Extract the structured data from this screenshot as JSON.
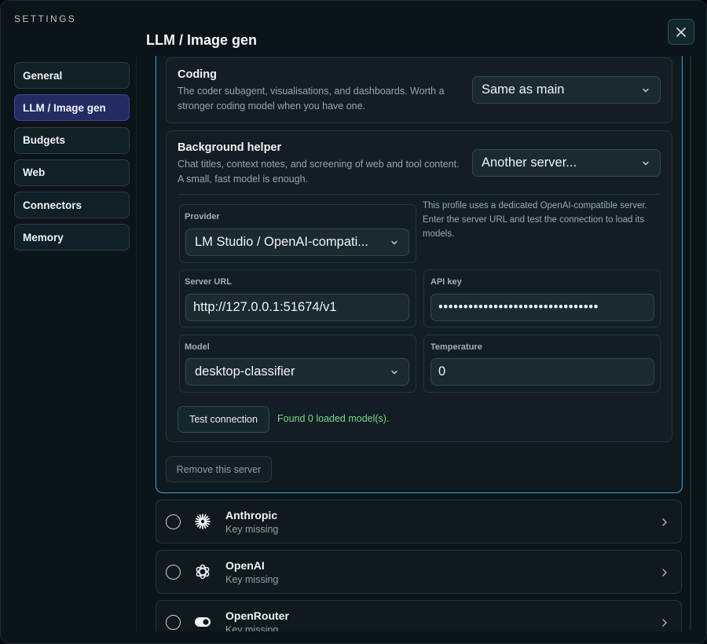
{
  "header": {
    "settings_label": "SETTINGS",
    "page_title": "LLM / Image gen"
  },
  "sidebar": {
    "items": [
      {
        "label": "General",
        "active": false
      },
      {
        "label": "LLM / Image gen",
        "active": true
      },
      {
        "label": "Budgets",
        "active": false
      },
      {
        "label": "Web",
        "active": false
      },
      {
        "label": "Connectors",
        "active": false
      },
      {
        "label": "Memory",
        "active": false
      }
    ]
  },
  "coding": {
    "title": "Coding",
    "description": "The coder subagent, visualisations, and dashboards. Worth a stronger coding model when you have one.",
    "selected": "Same as main"
  },
  "background": {
    "title": "Background helper",
    "description": "Chat titles, context notes, and screening of web and tool content. A small, fast model is enough.",
    "selected": "Another server...",
    "hint": "This profile uses a dedicated OpenAI-compatible server. Enter the server URL and test the connection to load its models.",
    "provider_label": "Provider",
    "provider_value": "LM Studio / OpenAI-compati...",
    "server_url_label": "Server URL",
    "server_url_value": "http://127.0.0.1:51674/v1",
    "api_key_label": "API key",
    "api_key_value": "••••••••••••••••••••••••••••••••",
    "model_label": "Model",
    "model_value": "desktop-classifier",
    "temperature_label": "Temperature",
    "temperature_value": "0",
    "test_button": "Test connection",
    "test_result": "Found 0 loaded model(s)."
  },
  "remove_button": "Remove this server",
  "providers": [
    {
      "name": "Anthropic",
      "status": "Key missing",
      "icon": "anthropic-icon"
    },
    {
      "name": "OpenAI",
      "status": "Key missing",
      "icon": "openai-icon"
    },
    {
      "name": "OpenRouter",
      "status": "Key missing",
      "icon": "openrouter-icon"
    }
  ],
  "colors": {
    "accent": "#3aa7d8",
    "active_nav": "#242c63",
    "success": "#7fd48d",
    "background": "#0b1418"
  }
}
